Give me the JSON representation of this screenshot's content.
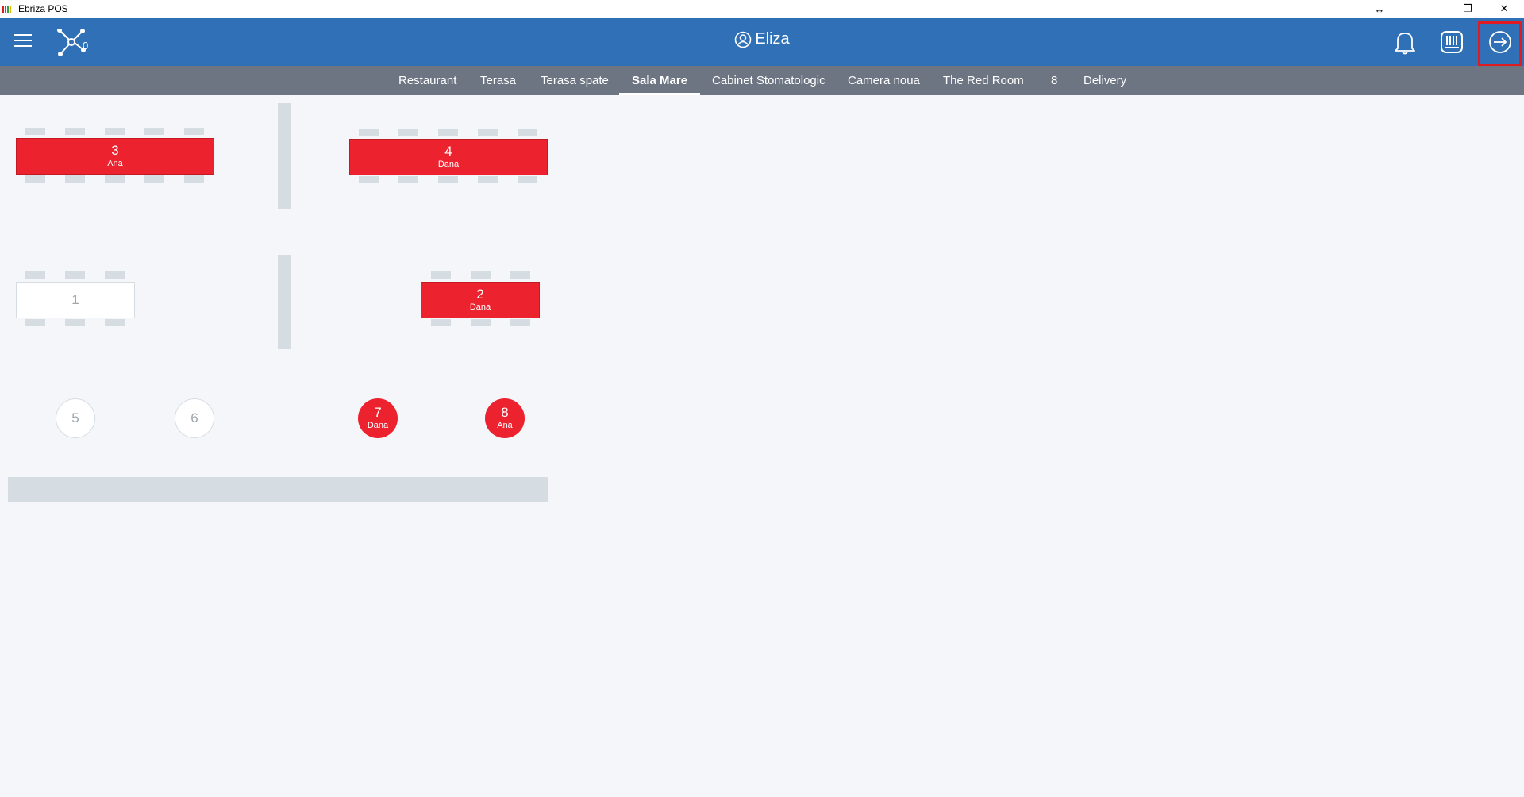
{
  "window": {
    "title": "Ebriza POS",
    "controls": {
      "resize": "↔",
      "minimize": "—",
      "restore": "❐",
      "close": "✕"
    },
    "icon_colors": [
      "#e11b22",
      "#2f70b6",
      "#27a844",
      "#f2b705"
    ]
  },
  "header": {
    "user_name": "Eliza",
    "network_count": "0",
    "color": "#2f70b6"
  },
  "tabs": [
    {
      "label": "Restaurant",
      "active": false
    },
    {
      "label": "Terasa",
      "active": false
    },
    {
      "label": "Terasa spate",
      "active": false
    },
    {
      "label": "Sala Mare",
      "active": true
    },
    {
      "label": "Cabinet Stomatologic",
      "active": false
    },
    {
      "label": "Camera noua",
      "active": false
    },
    {
      "label": "The Red Room",
      "active": false
    },
    {
      "label": "8",
      "active": false
    },
    {
      "label": "Delivery",
      "active": false
    }
  ],
  "tables": [
    {
      "number": "3",
      "waiter": "Ana",
      "status": "busy"
    },
    {
      "number": "4",
      "waiter": "Dana",
      "status": "busy"
    },
    {
      "number": "1",
      "waiter": "",
      "status": "free"
    },
    {
      "number": "2",
      "waiter": "Dana",
      "status": "busy"
    },
    {
      "number": "5",
      "waiter": "",
      "status": "free"
    },
    {
      "number": "6",
      "waiter": "",
      "status": "free"
    },
    {
      "number": "7",
      "waiter": "Dana",
      "status": "busy"
    },
    {
      "number": "8",
      "waiter": "Ana",
      "status": "busy"
    }
  ],
  "colors": {
    "busy": "#ec222f",
    "free": "#ffffff",
    "tab_bar": "#6d7583",
    "floor": "#f4f6fa",
    "highlight": "#e11b22"
  }
}
